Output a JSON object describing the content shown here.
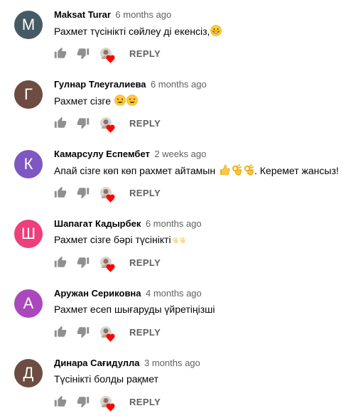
{
  "comments": [
    {
      "initial": "M",
      "color": "#455a64",
      "author": "Maksat Turar",
      "time": "6 months ago",
      "text": "Рахмет түсінікті сөйлеу ді екенсіз,",
      "emoji": [
        "grin"
      ]
    },
    {
      "initial": "Г",
      "color": "#6d4c41",
      "author": "Гулнар Тлеугалиева",
      "time": "6 months ago",
      "text": "Рахмет сізге ",
      "emoji": [
        "heart-eyes",
        "heart-eyes"
      ]
    },
    {
      "initial": "К",
      "color": "#7e57c2",
      "author": "Камарсулу Еспембет",
      "time": "2 weeks ago",
      "text": "Апай сізге көп көп рахмет айтамын ",
      "emoji": [
        "thumbs-up",
        "ok-hand",
        "ok-hand"
      ],
      "text_after": ". Керемет жансыз!"
    },
    {
      "initial": "Ш",
      "color": "#ec407a",
      "author": "Шапагат Кадырбек",
      "time": "6 months ago",
      "text": "Рахмет сізге бәрі түсінікті",
      "emoji": [
        "ok-small",
        "ok-small"
      ]
    },
    {
      "initial": "А",
      "color": "#ab47bc",
      "author": "Аружан Сериковна",
      "time": "4 months ago",
      "text": "Рахмет есеп шығаруды үйретіңізші",
      "emoji": []
    },
    {
      "initial": "Д",
      "color": "#6d4c41",
      "author": "Динара Сағидулла",
      "time": "3 months ago",
      "text": "Түсінікті болды рақмет",
      "emoji": []
    }
  ],
  "reply_label": "REPLY",
  "icons": {
    "like": "thumbs-up-icon",
    "dislike": "thumbs-down-icon",
    "heart": "creator-heart-icon"
  }
}
